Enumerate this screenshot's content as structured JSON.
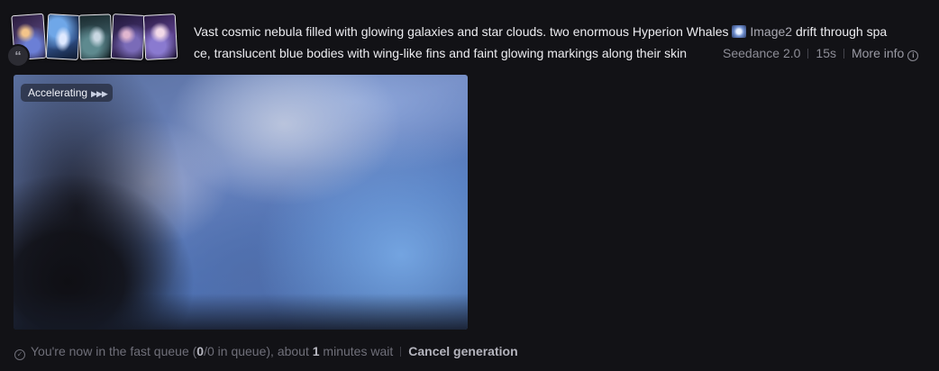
{
  "thumbnails": [
    {
      "name": "reference-image-1"
    },
    {
      "name": "reference-image-2"
    },
    {
      "name": "reference-image-3"
    },
    {
      "name": "reference-image-4"
    },
    {
      "name": "reference-image-5"
    }
  ],
  "quote_icon": "“",
  "prompt": {
    "line1_before": "Vast cosmic nebula filled with glowing galaxies and star clouds. two enormous Hyperion Whales ",
    "image_ref_label": "Image2",
    "line1_after": " drift through spa",
    "line2": "ce, translucent blue bodies with wing-like fins and faint glowing markings along their skin"
  },
  "meta": {
    "model": "Seedance 2.0",
    "duration": "15s",
    "more_info": "More info",
    "info_icon": "i"
  },
  "preview": {
    "badge_label": "Accelerating",
    "badge_arrows": "▶▶▶"
  },
  "status": {
    "icon": "✓",
    "text_before": "You're now in the fast queue (",
    "queue_position": "0",
    "text_mid": "/0 in queue), about ",
    "wait_minutes": "1",
    "text_after": " minutes wait",
    "cancel_label": "Cancel generation"
  }
}
